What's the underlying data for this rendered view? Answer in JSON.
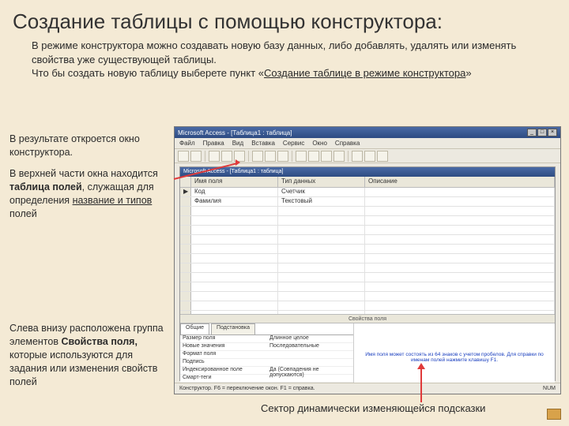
{
  "title": "Создание таблицы с помощью конструктора:",
  "intro": {
    "l1": "В режиме конструктора можно создавать новую базу данных, либо добавлять, удалять или изменять свойства уже существующей таблицы.",
    "l2a": "Что бы создать новую таблицу выберете пункт «",
    "l2link": "Создание таблице в режиме конструктора",
    "l2b": "»"
  },
  "left": {
    "p1": "В результате откроется окно конструктора.",
    "p2a": "В верхней части окна находится ",
    "p2b": "таблица полей",
    "p2c": ", служащая для определения ",
    "p2link": "название и типов",
    "p2d": " полей",
    "p3a": "Слева  внизу расположена группа элементов ",
    "p3b": "Свойства поля,",
    "p3c": " которые используются для задания или изменения свойств полей"
  },
  "caption": "Сектор динамически изменяющейся подсказки",
  "app": {
    "title": "Microsoft Access - [Таблица1 : таблица]",
    "menus": [
      "Файл",
      "Правка",
      "Вид",
      "Вставка",
      "Сервис",
      "Окно",
      "Справка"
    ],
    "grid_headers": {
      "name": "Имя поля",
      "type": "Тип данных",
      "desc": "Описание"
    },
    "rows": [
      {
        "sel": "▶",
        "name": "Код",
        "type": "Счетчик"
      },
      {
        "sel": "",
        "name": "Фамилия",
        "type": "Текстовый"
      },
      {
        "sel": "",
        "name": "",
        "type": ""
      }
    ],
    "midbar": "Свойства поля",
    "tabs": {
      "general": "Общие",
      "lookup": "Подстановка"
    },
    "props": [
      {
        "k": "Размер поля",
        "v": "Длинное целое"
      },
      {
        "k": "Новые значения",
        "v": "Последовательные"
      },
      {
        "k": "Формат поля",
        "v": ""
      },
      {
        "k": "Подпись",
        "v": ""
      },
      {
        "k": "Индексированное поле",
        "v": "Да (Совпадения не допускаются)"
      },
      {
        "k": "Смарт-теги",
        "v": ""
      }
    ],
    "hint": "Имя поля может состоять из 64 знаков с учетом пробелов. Для справки по именам полей нажмите клавишу F1.",
    "status_left": "Конструктор. F6 = переключение окон. F1 = справка.",
    "status_right": "NUM"
  }
}
